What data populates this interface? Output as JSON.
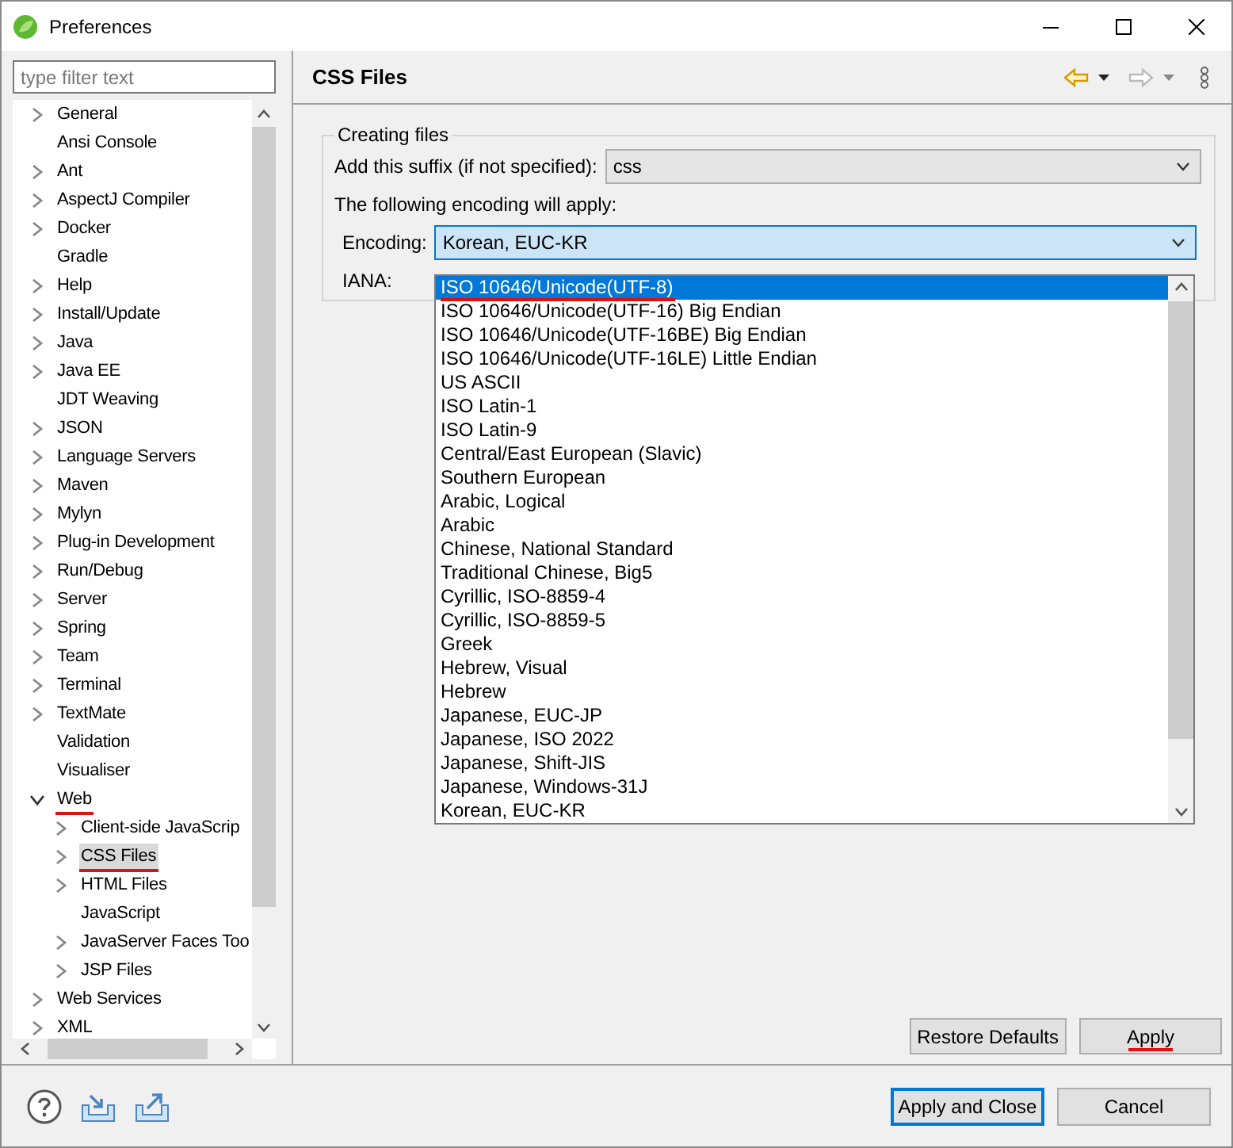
{
  "window": {
    "title": "Preferences"
  },
  "filter": {
    "placeholder": "type filter text"
  },
  "tree": [
    {
      "label": "General",
      "kind": "expandable",
      "expanded": false,
      "selected": false,
      "underlined": false
    },
    {
      "label": "Ansi Console",
      "kind": "leaf",
      "selected": false,
      "underlined": false
    },
    {
      "label": "Ant",
      "kind": "expandable",
      "expanded": false,
      "selected": false,
      "underlined": false
    },
    {
      "label": "AspectJ Compiler",
      "kind": "expandable",
      "expanded": false,
      "selected": false,
      "underlined": false
    },
    {
      "label": "Docker",
      "kind": "expandable",
      "expanded": false,
      "selected": false,
      "underlined": false
    },
    {
      "label": "Gradle",
      "kind": "leaf",
      "selected": false,
      "underlined": false
    },
    {
      "label": "Help",
      "kind": "expandable",
      "expanded": false,
      "selected": false,
      "underlined": false
    },
    {
      "label": "Install/Update",
      "kind": "expandable",
      "expanded": false,
      "selected": false,
      "underlined": false
    },
    {
      "label": "Java",
      "kind": "expandable",
      "expanded": false,
      "selected": false,
      "underlined": false
    },
    {
      "label": "Java EE",
      "kind": "expandable",
      "expanded": false,
      "selected": false,
      "underlined": false
    },
    {
      "label": "JDT Weaving",
      "kind": "leaf",
      "selected": false,
      "underlined": false
    },
    {
      "label": "JSON",
      "kind": "expandable",
      "expanded": false,
      "selected": false,
      "underlined": false
    },
    {
      "label": "Language Servers",
      "kind": "expandable",
      "expanded": false,
      "selected": false,
      "underlined": false
    },
    {
      "label": "Maven",
      "kind": "expandable",
      "expanded": false,
      "selected": false,
      "underlined": false
    },
    {
      "label": "Mylyn",
      "kind": "expandable",
      "expanded": false,
      "selected": false,
      "underlined": false
    },
    {
      "label": "Plug-in Development",
      "kind": "expandable",
      "expanded": false,
      "selected": false,
      "underlined": false
    },
    {
      "label": "Run/Debug",
      "kind": "expandable",
      "expanded": false,
      "selected": false,
      "underlined": false
    },
    {
      "label": "Server",
      "kind": "expandable",
      "expanded": false,
      "selected": false,
      "underlined": false
    },
    {
      "label": "Spring",
      "kind": "expandable",
      "expanded": false,
      "selected": false,
      "underlined": false
    },
    {
      "label": "Team",
      "kind": "expandable",
      "expanded": false,
      "selected": false,
      "underlined": false
    },
    {
      "label": "Terminal",
      "kind": "expandable",
      "expanded": false,
      "selected": false,
      "underlined": false
    },
    {
      "label": "TextMate",
      "kind": "expandable",
      "expanded": false,
      "selected": false,
      "underlined": false
    },
    {
      "label": "Validation",
      "kind": "leaf",
      "selected": false,
      "underlined": false
    },
    {
      "label": "Visualiser",
      "kind": "leaf",
      "selected": false,
      "underlined": false
    },
    {
      "label": "Web",
      "kind": "expandable",
      "expanded": true,
      "selected": false,
      "underlined": true,
      "children": [
        {
          "label": "Client-side JavaScrip",
          "kind": "expandable",
          "expanded": false,
          "selected": false,
          "underlined": false
        },
        {
          "label": "CSS Files",
          "kind": "expandable",
          "expanded": false,
          "selected": true,
          "underlined": true
        },
        {
          "label": "HTML Files",
          "kind": "expandable",
          "expanded": false,
          "selected": false,
          "underlined": false
        },
        {
          "label": "JavaScript",
          "kind": "leaf",
          "selected": false,
          "underlined": false
        },
        {
          "label": "JavaServer Faces Too",
          "kind": "expandable",
          "expanded": false,
          "selected": false,
          "underlined": false
        },
        {
          "label": "JSP Files",
          "kind": "expandable",
          "expanded": false,
          "selected": false,
          "underlined": false
        }
      ]
    },
    {
      "label": "Web Services",
      "kind": "expandable",
      "expanded": false,
      "selected": false,
      "underlined": false
    },
    {
      "label": "XML",
      "kind": "expandable",
      "expanded": false,
      "selected": false,
      "underlined": false
    }
  ],
  "page": {
    "title": "CSS Files",
    "group": {
      "title": "Creating files",
      "suffix": {
        "label": "Add this suffix (if not specified):",
        "value": "css"
      },
      "note": "The following encoding will apply:",
      "encoding": {
        "label": "Encoding:",
        "value": "Korean, EUC-KR"
      },
      "iana": {
        "label": "IANA:"
      }
    },
    "encoding_options": [
      {
        "label": "ISO 10646/Unicode(UTF-8)",
        "selected": true,
        "underlined": true
      },
      {
        "label": "ISO 10646/Unicode(UTF-16) Big Endian",
        "selected": false,
        "underlined": false
      },
      {
        "label": "ISO 10646/Unicode(UTF-16BE) Big Endian",
        "selected": false,
        "underlined": false
      },
      {
        "label": "ISO 10646/Unicode(UTF-16LE) Little Endian",
        "selected": false,
        "underlined": false
      },
      {
        "label": "US ASCII",
        "selected": false,
        "underlined": false
      },
      {
        "label": "ISO Latin-1",
        "selected": false,
        "underlined": false
      },
      {
        "label": "ISO Latin-9",
        "selected": false,
        "underlined": false
      },
      {
        "label": "Central/East European (Slavic)",
        "selected": false,
        "underlined": false
      },
      {
        "label": "Southern European",
        "selected": false,
        "underlined": false
      },
      {
        "label": "Arabic, Logical",
        "selected": false,
        "underlined": false
      },
      {
        "label": "Arabic",
        "selected": false,
        "underlined": false
      },
      {
        "label": "Chinese, National Standard",
        "selected": false,
        "underlined": false
      },
      {
        "label": "Traditional Chinese, Big5",
        "selected": false,
        "underlined": false
      },
      {
        "label": "Cyrillic, ISO-8859-4",
        "selected": false,
        "underlined": false
      },
      {
        "label": "Cyrillic, ISO-8859-5",
        "selected": false,
        "underlined": false
      },
      {
        "label": "Greek",
        "selected": false,
        "underlined": false
      },
      {
        "label": "Hebrew, Visual",
        "selected": false,
        "underlined": false
      },
      {
        "label": "Hebrew",
        "selected": false,
        "underlined": false
      },
      {
        "label": "Japanese, EUC-JP",
        "selected": false,
        "underlined": false
      },
      {
        "label": "Japanese, ISO 2022",
        "selected": false,
        "underlined": false
      },
      {
        "label": "Japanese, Shift-JIS",
        "selected": false,
        "underlined": false
      },
      {
        "label": "Japanese, Windows-31J",
        "selected": false,
        "underlined": false
      },
      {
        "label": "Korean, EUC-KR",
        "selected": false,
        "underlined": false
      }
    ],
    "buttons": [
      {
        "label": "Restore Defaults",
        "underlined": false
      },
      {
        "label": "Apply",
        "underlined": true
      }
    ]
  },
  "footer": {
    "buttons": [
      {
        "label": "Apply and Close",
        "default": true
      },
      {
        "label": "Cancel",
        "default": false
      }
    ]
  }
}
